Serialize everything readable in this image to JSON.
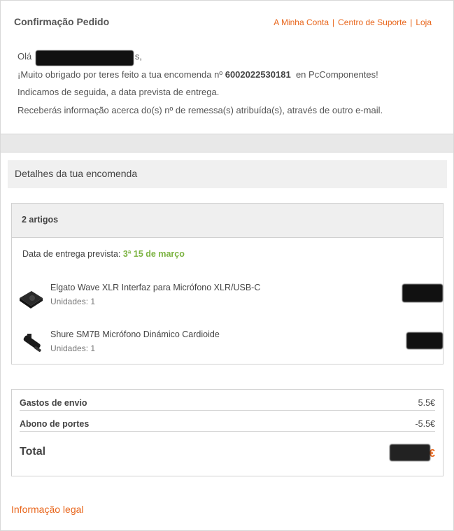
{
  "header": {
    "title": "Confirmação Pedido",
    "links": [
      "A Minha Conta",
      "Centro de Suporte",
      "Loja"
    ]
  },
  "greeting": {
    "hello": "Olá",
    "name_suffix": "s,",
    "line2_pre": "¡Muito obrigado por teres feito a tua encomenda nº",
    "order_number": "6002022530181",
    "line2_post": "en PcComponentes!",
    "line3": "Indicamos de seguida, a data prevista de entrega.",
    "line4": "Receberás informação acerca do(s) nº de remessa(s) atribuída(s), através de outro e-mail."
  },
  "section": {
    "title": "Detalhes da tua encomenda"
  },
  "order": {
    "count_label": "2 artigos",
    "delivery_label": "Data de entrega prevista:",
    "delivery_date": "3ª 15 de março",
    "items": [
      {
        "name": "Elgato Wave XLR Interfaz para Micrófono XLR/USB-C",
        "units": "Unidades: 1",
        "icon": "audio-interface-icon"
      },
      {
        "name": "Shure SM7B Micrófono Dinámico Cardioide",
        "units": "Unidades: 1",
        "icon": "microphone-icon"
      }
    ]
  },
  "totals": {
    "shipping_label": "Gastos de envio",
    "shipping_value": "5.5€",
    "discount_label": "Abono de portes",
    "discount_value": "-5.5€",
    "total_label": "Total",
    "total_currency": "€"
  },
  "footer": {
    "legal": "Informação legal"
  },
  "colors": {
    "accent": "#e8661c",
    "delivery_green": "#7cb342"
  }
}
